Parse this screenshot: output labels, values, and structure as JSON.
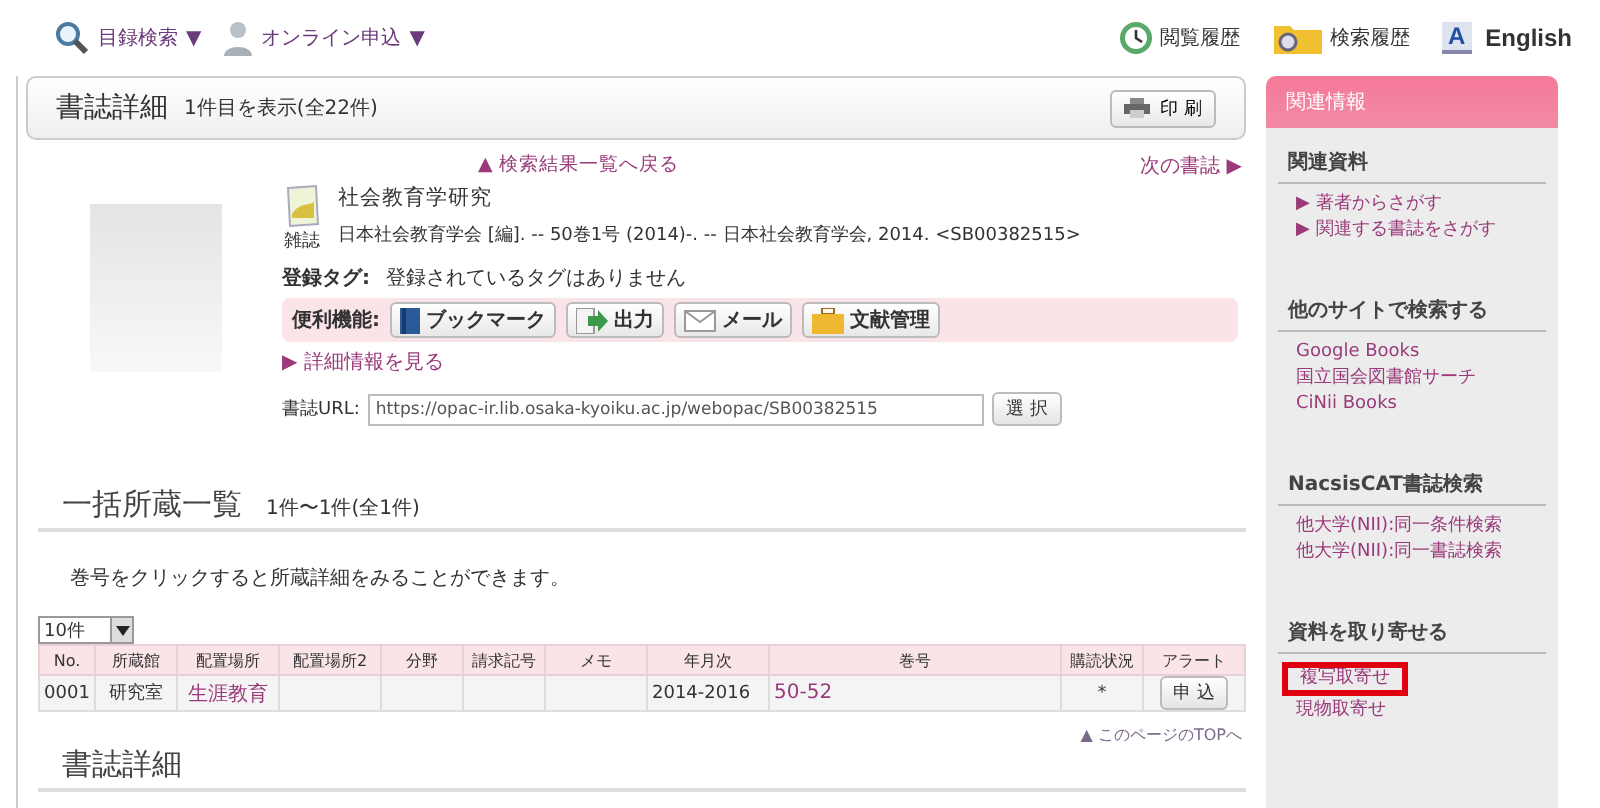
{
  "top_nav": {
    "left": [
      {
        "label": "目録検索",
        "kind": "search"
      },
      {
        "label": "オンライン申込",
        "kind": "person"
      }
    ],
    "right": [
      {
        "label": "閲覧履歴",
        "kind": "history"
      },
      {
        "label": "検索履歴",
        "kind": "folder"
      },
      {
        "label": "English",
        "kind": "lang",
        "glyph": "A"
      }
    ],
    "caret": "▼"
  },
  "header": {
    "title": "書誌詳細",
    "count": "1件目を表示(全22件)",
    "print_button": "印 刷"
  },
  "record": {
    "back_link": "▲ 検索結果一覧へ戻る",
    "next_link": "次の書誌 ▶",
    "type_label": "雑誌",
    "title": "社会教育学研究",
    "description": "日本社会教育学会 [編]. -- 50巻1号 (2014)-. -- 日本社会教育学会, 2014. <SB00382515>",
    "tags_label": "登録タグ:",
    "tags_value": "登録されているタグはありません",
    "tools_label": "便利機能:",
    "tools": [
      {
        "label": "ブックマーク",
        "kind": "book"
      },
      {
        "label": "出力",
        "kind": "export"
      },
      {
        "label": "メール",
        "kind": "mail"
      },
      {
        "label": "文献管理",
        "kind": "briefcase"
      }
    ],
    "detail_link": "▶ 詳細情報を見る",
    "url_label": "書誌URL:",
    "url": "https://opac-ir.lib.osaka-kyoiku.ac.jp/webopac/SB00382515",
    "select_button": "選 択"
  },
  "holdings": {
    "title": "一括所蔵一覧",
    "count": "1件〜1件(全1件)",
    "note": "巻号をクリックすると所蔵詳細をみることができます。",
    "page_size": "10件",
    "columns": [
      "No.",
      "所蔵館",
      "配置場所",
      "配置場所2",
      "分野",
      "請求記号",
      "メモ",
      "年月次",
      "巻号",
      "購読状況",
      "アラート"
    ],
    "rows": [
      [
        {
          "kind": "text",
          "text": "0001"
        },
        {
          "kind": "text",
          "text": "研究室"
        },
        {
          "kind": "link",
          "text": "生涯教育"
        },
        {
          "kind": "empty"
        },
        {
          "kind": "empty"
        },
        {
          "kind": "empty"
        },
        {
          "kind": "empty"
        },
        {
          "kind": "text",
          "text": "2014-2016"
        },
        {
          "kind": "link",
          "text": "50-52"
        },
        {
          "kind": "text",
          "text": "*"
        },
        {
          "kind": "button",
          "text": "申 込"
        }
      ]
    ],
    "top_link": "▲ このページのTOPへ"
  },
  "next_section": {
    "title": "書誌詳細"
  },
  "sidebar": {
    "header": "関連情報",
    "sections": [
      {
        "title": "関連資料",
        "links": [
          {
            "text": "▶ 著者からさがす",
            "highlighted": false
          },
          {
            "text": "▶ 関連する書誌をさがす",
            "highlighted": false
          }
        ]
      },
      {
        "title": "他のサイトで検索する",
        "links": [
          {
            "text": "Google Books",
            "highlighted": false
          },
          {
            "text": "国立国会図書館サーチ",
            "highlighted": false
          },
          {
            "text": "CiNii Books",
            "highlighted": false
          }
        ]
      },
      {
        "title": "NacsisCAT書誌検索",
        "links": [
          {
            "text": "他大学(NII):同一条件検索",
            "highlighted": false
          },
          {
            "text": "他大学(NII):同一書誌検索",
            "highlighted": false
          }
        ]
      },
      {
        "title": "資料を取り寄せる",
        "links": [
          {
            "text": "複写取寄せ",
            "highlighted": true
          },
          {
            "text": "現物取寄せ",
            "highlighted": false
          }
        ]
      }
    ]
  }
}
